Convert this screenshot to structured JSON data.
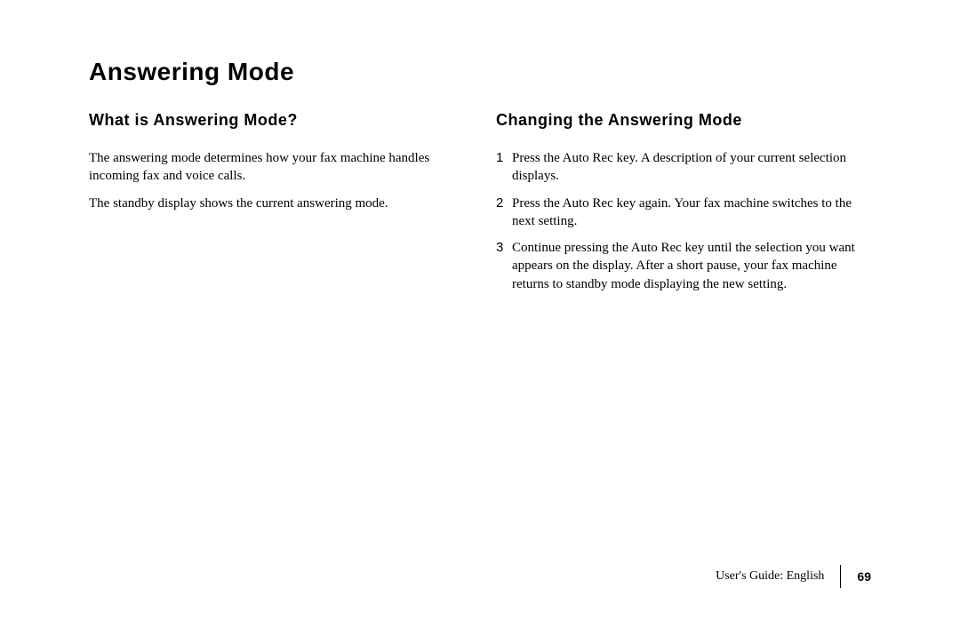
{
  "title": "Answering Mode",
  "left": {
    "heading": "What is Answering Mode?",
    "paragraphs": [
      "The answering mode determines how your fax machine handles incoming fax and voice calls.",
      "The standby display shows the current answering mode."
    ]
  },
  "right": {
    "heading": "Changing the Answering Mode",
    "steps": [
      {
        "num": "1",
        "text": "Press the Auto Rec key. A description of your current selection displays."
      },
      {
        "num": "2",
        "text": "Press the Auto Rec key again. Your fax machine switches to the next setting."
      },
      {
        "num": "3",
        "text": "Continue pressing the Auto Rec key until the selection you want appears on the display. After a short pause, your fax machine returns to standby mode displaying the new setting."
      }
    ]
  },
  "footer": {
    "label": "User's Guide:  English",
    "page": "69"
  }
}
